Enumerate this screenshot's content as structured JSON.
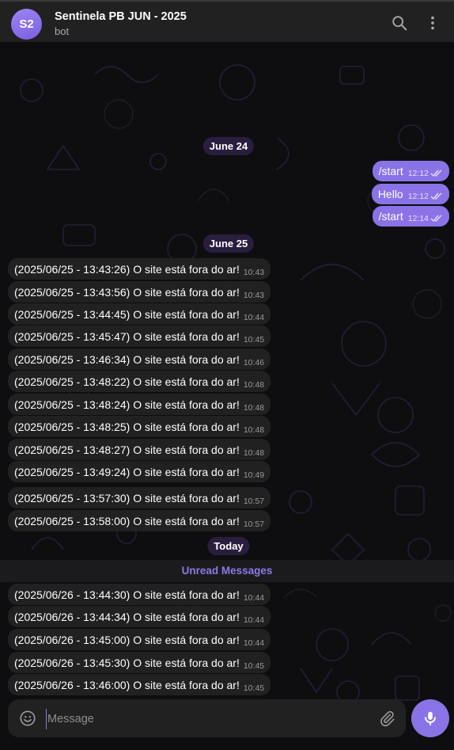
{
  "header": {
    "avatar_initials": "S2",
    "title": "Sentinela PB JUN - 2025",
    "subtitle": "bot"
  },
  "dates": {
    "june24": "June 24",
    "june25": "June 25",
    "today": "Today"
  },
  "outgoing": [
    {
      "text": "/start",
      "time": "12:12"
    },
    {
      "text": "Hello",
      "time": "12:12"
    },
    {
      "text": "/start",
      "time": "12:14"
    }
  ],
  "incoming_june25": [
    {
      "text": "(2025/06/25 - 13:43:26) O site está fora do ar!",
      "time": "10:43"
    },
    {
      "text": "(2025/06/25 - 13:43:56) O site está fora do ar!",
      "time": "10:43"
    },
    {
      "text": "(2025/06/25 - 13:44:45) O site está fora do ar!",
      "time": "10:44"
    },
    {
      "text": "(2025/06/25 - 13:45:47) O site está fora do ar!",
      "time": "10:45"
    },
    {
      "text": "(2025/06/25 - 13:46:34) O site está fora do ar!",
      "time": "10:46"
    },
    {
      "text": "(2025/06/25 - 13:48:22) O site está fora do ar!",
      "time": "10:48"
    },
    {
      "text": "(2025/06/25 - 13:48:24) O site está fora do ar!",
      "time": "10:48"
    },
    {
      "text": "(2025/06/25 - 13:48:25) O site está fora do ar!",
      "time": "10:48"
    },
    {
      "text": "(2025/06/25 - 13:48:27) O site está fora do ar!",
      "time": "10:48"
    },
    {
      "text": "(2025/06/25 - 13:49:24) O site está fora do ar!",
      "time": "10:49"
    },
    {
      "text": "(2025/06/25 - 13:57:30) O site está fora do ar!",
      "time": "10:57"
    },
    {
      "text": "(2025/06/25 - 13:58:00) O site está fora do ar!",
      "time": "10:57"
    }
  ],
  "unread_label": "Unread Messages",
  "incoming_today": [
    {
      "text": "(2025/06/26 - 13:44:30) O site está fora do ar!",
      "time": "10:44"
    },
    {
      "text": "(2025/06/26 - 13:44:34) O site está fora do ar!",
      "time": "10:44"
    },
    {
      "text": "(2025/06/26 - 13:45:00) O site está fora do ar!",
      "time": "10:44"
    },
    {
      "text": "(2025/06/26 - 13:45:30) O site está fora do ar!",
      "time": "10:45"
    },
    {
      "text": "(2025/06/26 - 13:46:00) O site está fora do ar!",
      "time": "10:45"
    }
  ],
  "composer": {
    "placeholder": "Message"
  },
  "colors": {
    "accent": "#8a73e6",
    "bubble_in": "#212121",
    "header_bg": "#212121",
    "date_pill": "#2a1e3f"
  }
}
